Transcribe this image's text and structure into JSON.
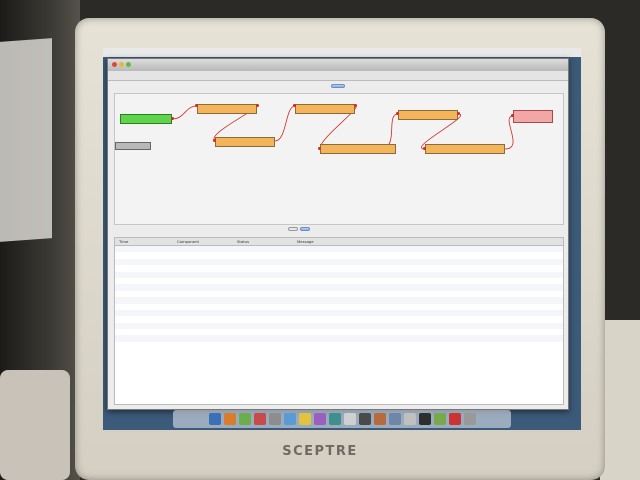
{
  "monitor": {
    "brand": "SCEPTRE"
  },
  "menubar": {
    "apple": "",
    "items": "",
    "clock": ""
  },
  "window": {
    "title": "",
    "menu": [
      "",
      "",
      "",
      ""
    ],
    "top_tab": ""
  },
  "canvas": {
    "nodes": [
      {
        "label": "",
        "color": "#5fd34a"
      },
      {
        "label": "",
        "color": "#b9b9b9"
      },
      {
        "label": "",
        "color": "#f3b45a"
      },
      {
        "label": "",
        "color": "#f3b45a"
      },
      {
        "label": "",
        "color": "#f3b45a"
      },
      {
        "label": "",
        "color": "#f3b45a"
      },
      {
        "label": "",
        "color": "#f3b45a"
      },
      {
        "label": "",
        "color": "#f3b45a"
      },
      {
        "label": "",
        "color": "#f2a6a6"
      }
    ]
  },
  "bottom_tabs": [
    "",
    ""
  ],
  "log": {
    "columns": [
      "Time",
      "Component",
      "Status",
      "Message"
    ],
    "rows": [
      [
        "",
        "",
        "",
        ""
      ],
      [
        "",
        "",
        "",
        ""
      ],
      [
        "",
        "",
        "",
        ""
      ],
      [
        "",
        "",
        "",
        ""
      ],
      [
        "",
        "",
        "",
        ""
      ],
      [
        "",
        "",
        "",
        ""
      ],
      [
        "",
        "",
        "",
        ""
      ],
      [
        "",
        "",
        "",
        ""
      ],
      [
        "",
        "",
        "",
        ""
      ],
      [
        "",
        "",
        "",
        ""
      ],
      [
        "",
        "",
        "",
        ""
      ],
      [
        "",
        "",
        "",
        ""
      ],
      [
        "",
        "",
        "",
        ""
      ],
      [
        "",
        "",
        "",
        ""
      ],
      [
        "",
        "",
        "",
        ""
      ],
      [
        "",
        "",
        "",
        ""
      ]
    ]
  },
  "dock": {
    "icons": [
      "#3b6fb6",
      "#d97c2b",
      "#6cae4a",
      "#c84a4a",
      "#8d8d8d",
      "#5a9bd5",
      "#e3c23e",
      "#9b5fc0",
      "#3f8f8f",
      "#d0d0d0",
      "#4a4a4a",
      "#b86b3a",
      "#6f86a8",
      "#c0c0c0",
      "#2e2e2e",
      "#7aa84c",
      "#cc3333",
      "#999999"
    ]
  }
}
